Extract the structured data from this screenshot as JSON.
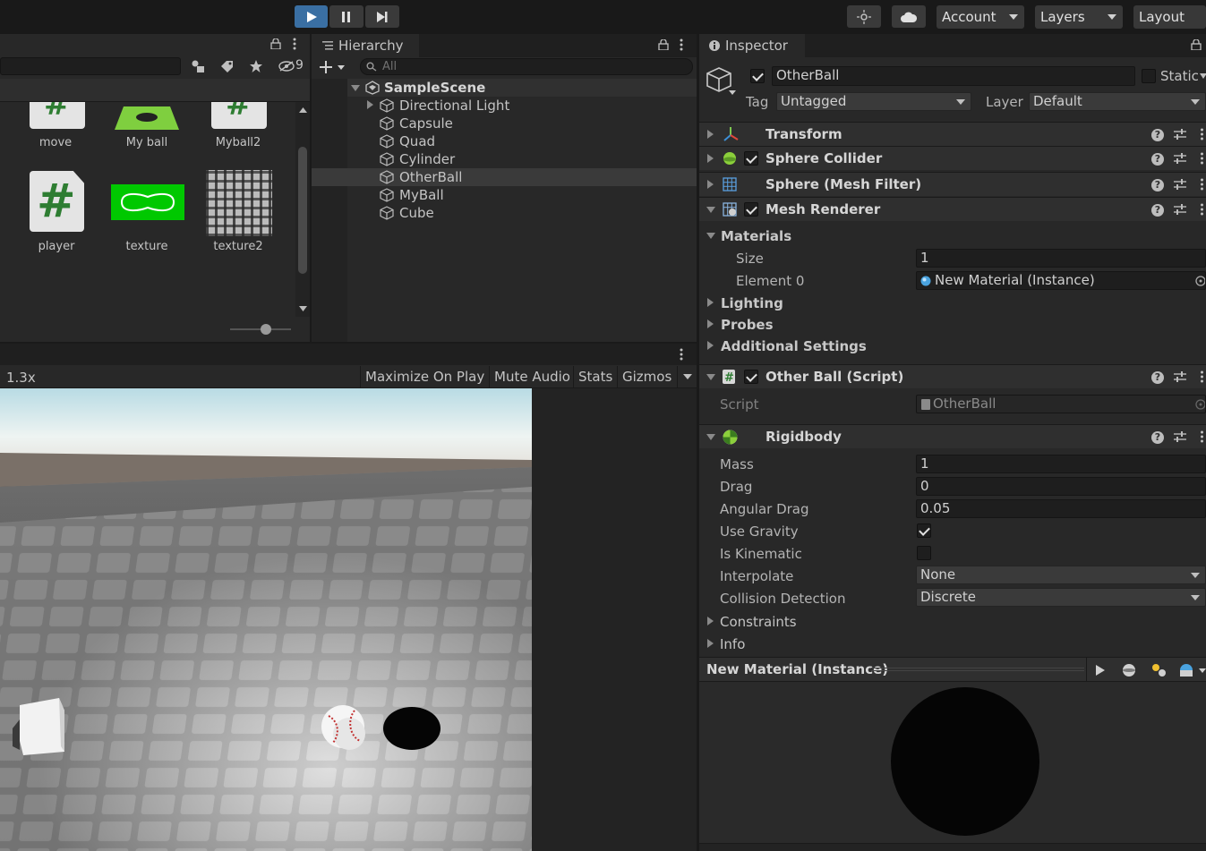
{
  "toolbar": {
    "account": "Account",
    "layers": "Layers",
    "layout": "Layout"
  },
  "project": {
    "hidden_count": "9",
    "assets": [
      {
        "label": "move"
      },
      {
        "label": "My ball"
      },
      {
        "label": "Myball2"
      },
      {
        "label": "player"
      },
      {
        "label": "texture"
      },
      {
        "label": "texture2"
      }
    ]
  },
  "hierarchy": {
    "tab": "Hierarchy",
    "search_placeholder": "All",
    "scene": "SampleScene",
    "items": [
      {
        "label": "Directional Light"
      },
      {
        "label": "Capsule"
      },
      {
        "label": "Quad"
      },
      {
        "label": "Cylinder"
      },
      {
        "label": "OtherBall"
      },
      {
        "label": "MyBall"
      },
      {
        "label": "Cube"
      }
    ],
    "selected_index": 4
  },
  "game": {
    "zoom": "1.3x",
    "buttons": [
      "Maximize On Play",
      "Mute Audio",
      "Stats",
      "Gizmos"
    ]
  },
  "inspector": {
    "tab": "Inspector",
    "object_name": "OtherBall",
    "static_label": "Static",
    "tag_label": "Tag",
    "tag_value": "Untagged",
    "layer_label": "Layer",
    "layer_value": "Default",
    "components": {
      "transform": "Transform",
      "sphere_collider": "Sphere Collider",
      "mesh_filter": "Sphere (Mesh Filter)",
      "mesh_renderer": "Mesh Renderer",
      "script": "Other Ball (Script)",
      "rigidbody": "Rigidbody"
    },
    "materials": {
      "label": "Materials",
      "size_label": "Size",
      "size_value": "1",
      "element_label": "Element 0",
      "element_value": "New Material (Instance)"
    },
    "renderer_sections": [
      "Lighting",
      "Probes",
      "Additional Settings"
    ],
    "script_label": "Script",
    "script_value": "OtherBall",
    "rigidbody": {
      "mass_label": "Mass",
      "mass": "1",
      "drag_label": "Drag",
      "drag": "0",
      "angular_drag_label": "Angular Drag",
      "angular_drag": "0.05",
      "use_gravity_label": "Use Gravity",
      "use_gravity": true,
      "is_kinematic_label": "Is Kinematic",
      "is_kinematic": false,
      "interpolate_label": "Interpolate",
      "interpolate": "None",
      "collision_label": "Collision Detection",
      "collision": "Discrete",
      "constraints": "Constraints",
      "info": "Info"
    },
    "material_preview": "New Material (Instance)"
  },
  "colors": {
    "accent": "#3a6fa3",
    "panel": "#282828",
    "header": "#2f2f2f"
  }
}
